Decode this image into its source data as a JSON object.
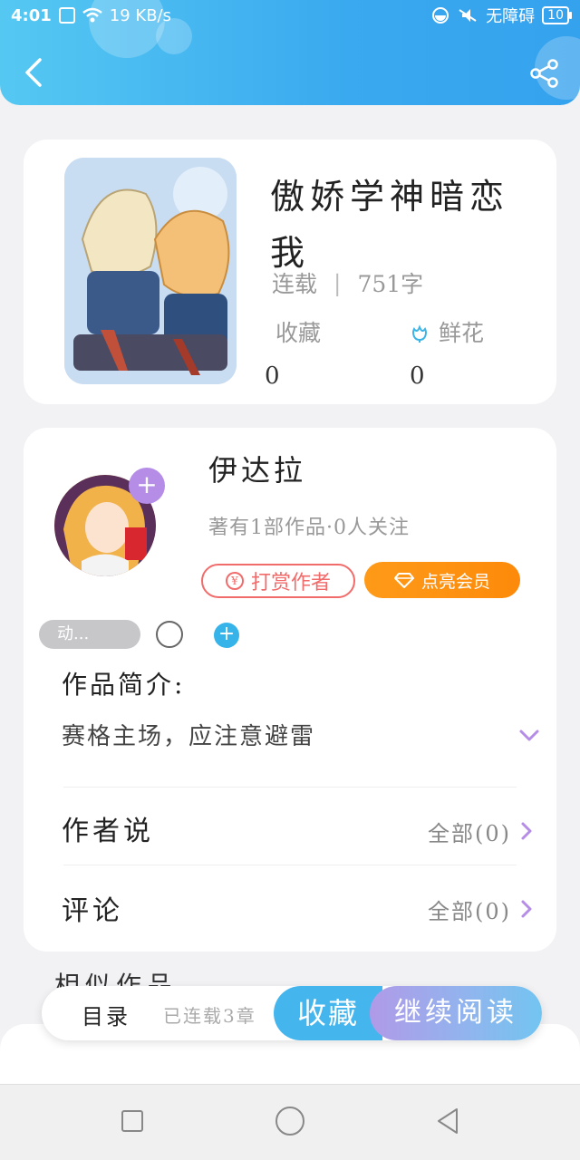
{
  "status_bar": {
    "time": "4:01",
    "network_speed": "19 KB/s",
    "accessibility": "无障碍",
    "battery": "10"
  },
  "header": {
    "back_icon": "chevron-left-icon",
    "share_icon": "share-icon",
    "accent_color": "#3aa9ef"
  },
  "book": {
    "title": "傲娇学神暗恋我",
    "status": "连载",
    "word_count": "751字",
    "favorites_label": "收藏",
    "favorites_value": "0",
    "flowers_label": "鲜花",
    "flowers_value": "0"
  },
  "author": {
    "name": "伊达拉",
    "meta": "著有1部作品·0人关注",
    "tip_label": "打赏作者",
    "vip_label": "点亮会员",
    "dynamic_label": "动..."
  },
  "intro": {
    "title": "作品简介:",
    "text": "赛格主场，应注意避雷"
  },
  "rows": [
    {
      "label": "作者说",
      "value": "全部(0)"
    },
    {
      "label": "评论",
      "value": "全部(0)"
    }
  ],
  "similar_title": "相似作品",
  "action_bar": {
    "catalog_label": "目录",
    "serial_label": "已连载3章",
    "collect_label": "收藏",
    "read_label": "继续阅读"
  },
  "colors": {
    "tip_red": "#f26b6b",
    "vip_orange": "#fe9a18",
    "purple_accent": "#b58ce6",
    "blue_accent": "#45b5ee"
  }
}
